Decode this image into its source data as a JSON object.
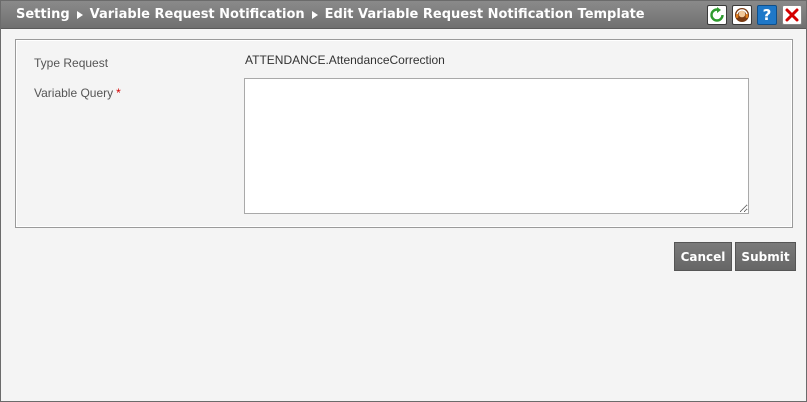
{
  "breadcrumb": {
    "items": [
      "Setting",
      "Variable Request Notification",
      "Edit Variable Request Notification Template"
    ]
  },
  "toolbar": {
    "icons": [
      "refresh-icon",
      "support-icon",
      "help-icon",
      "close-icon"
    ],
    "help_glyph": "?"
  },
  "form": {
    "type_request_label": "Type Request",
    "type_request_value": "ATTENDANCE.AttendanceCorrection",
    "variable_query_label": "Variable Query",
    "required_marker": "*",
    "variable_query_value": ""
  },
  "actions": {
    "cancel_label": "Cancel",
    "submit_label": "Submit"
  },
  "colors": {
    "titlebar": "#7a7a7a",
    "button": "#707070",
    "required": "#d40000",
    "help_icon": "#1f78c8",
    "close_icon": "#d40000"
  }
}
